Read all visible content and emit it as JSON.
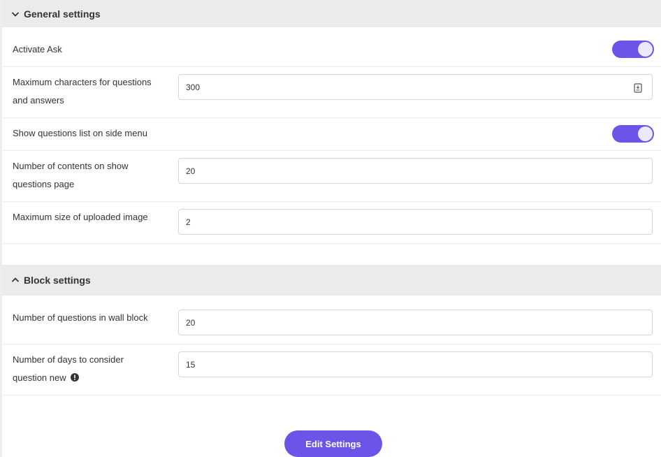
{
  "general": {
    "title": "General settings",
    "activate_ask": {
      "label": "Activate Ask",
      "enabled": true
    },
    "max_chars": {
      "label_line1": "Maximum characters for questions",
      "label_line2": "and answers",
      "value": "300"
    },
    "show_questions_list": {
      "label": "Show questions list on side menu",
      "enabled": true
    },
    "num_contents": {
      "label_line1": "Number of contents on show",
      "label_line2": "questions page",
      "value": "20"
    },
    "max_image_size": {
      "label": "Maximum size of uploaded image",
      "value": "2"
    }
  },
  "block": {
    "title": "Block settings",
    "wall_block": {
      "label": "Number of questions in wall block",
      "value": "20"
    },
    "days_new": {
      "label_line1": "Number of days to consider",
      "label_line2": "question new",
      "value": "15"
    }
  },
  "actions": {
    "edit_settings": "Edit Settings"
  },
  "colors": {
    "accent": "#6a55e8",
    "header_bg": "#ecebea"
  },
  "icons": {
    "general_chevron": "chevron-down-icon",
    "block_chevron": "chevron-up-icon",
    "counter": "text-counter-icon",
    "warning": "info-icon"
  }
}
